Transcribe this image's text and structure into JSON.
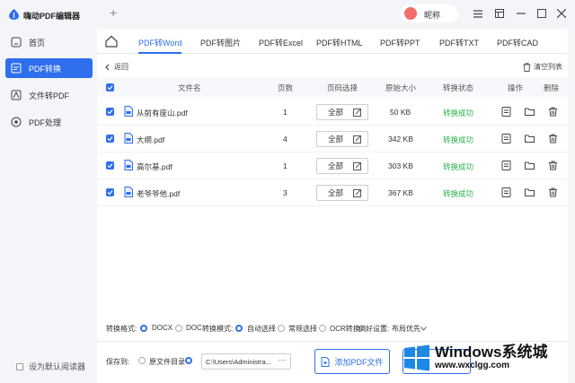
{
  "app": {
    "title": "嗨动PDF编辑器",
    "new_tab": "+",
    "nickname": "昵称"
  },
  "sidebar": {
    "items": [
      {
        "label": "首页",
        "icon": "home-icon"
      },
      {
        "label": "PDF转换",
        "icon": "convert-icon",
        "active": true
      },
      {
        "label": "文件转PDF",
        "icon": "file-to-pdf-icon"
      },
      {
        "label": "PDF处理",
        "icon": "process-icon"
      }
    ],
    "default_reader": "设为默认阅读器"
  },
  "tabs": [
    "PDF转Word",
    "PDF转图片",
    "PDF转Excel",
    "PDF转HTML",
    "PDF转PPT",
    "PDF转TXT",
    "PDF转CAD"
  ],
  "toolbar": {
    "back": "返回",
    "clear": "清空列表"
  },
  "table": {
    "headers": {
      "filename": "文件名",
      "pages": "页数",
      "page_select": "页码选择",
      "size": "原始大小",
      "status": "转换状态",
      "action": "操作",
      "delete": "删除"
    },
    "rows": [
      {
        "name": "从前有座山.pdf",
        "pages": "1",
        "select": "全部",
        "size": "50 KB",
        "status": "转换成功"
      },
      {
        "name": "大纲.pdf",
        "pages": "4",
        "select": "全部",
        "size": "342 KB",
        "status": "转换成功"
      },
      {
        "name": "高尔基.pdf",
        "pages": "1",
        "select": "全部",
        "size": "303 KB",
        "status": "转换成功"
      },
      {
        "name": "老爷爷他.pdf",
        "pages": "3",
        "select": "全部",
        "size": "367 KB",
        "status": "转换成功"
      }
    ]
  },
  "settings": {
    "format_label": "转换格式:",
    "docx": "DOCX",
    "doc": "DOC",
    "mode_label": "转换模式:",
    "auto": "自动选择",
    "normal": "常规选择",
    "ocr": "OCR转换",
    "pref_label": "偏好设置:",
    "pref_value": "布局优先"
  },
  "save": {
    "label": "保存到:",
    "source_dir": "原文件目录",
    "path": "C:\\Users\\Administra...",
    "more": "···",
    "add_pdf": "添加PDF文件"
  },
  "watermark": {
    "title": "Windows系统城",
    "url": "www.wxclgg.com"
  },
  "colors": {
    "accent": "#2f6fed",
    "success": "#2bb24c"
  }
}
